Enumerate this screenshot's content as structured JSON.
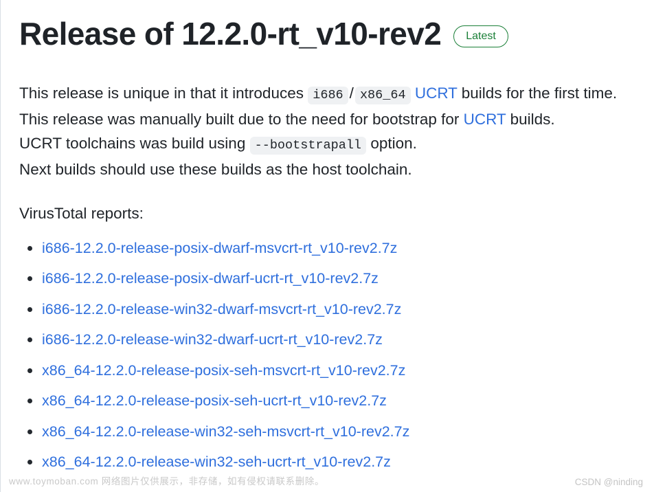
{
  "header": {
    "title": "Release of 12.2.0-rt_v10-rev2",
    "badge_label": "Latest",
    "badge_color": "#1a7f37"
  },
  "body": {
    "line1_part1": "This release is unique in that it introduces",
    "line1_code1": "i686",
    "line1_separator": "/",
    "line1_code2": "x86_64",
    "line1_link": "UCRT",
    "line1_part2": "builds for the first time.",
    "line2_part1": "This release was manually built due to the need for bootstrap for",
    "line2_link": "UCRT",
    "line2_part2": "builds.",
    "line3_part1": "UCRT toolchains was build using",
    "line3_code": "--bootstrapall",
    "line3_part2": "option.",
    "line4": "Next builds should use these builds as the host toolchain.",
    "link_color": "#2f6fdd",
    "code_bg": "#eff1f3"
  },
  "reports": {
    "heading": "VirusTotal reports:",
    "items": [
      "i686-12.2.0-release-posix-dwarf-msvcrt-rt_v10-rev2.7z",
      "i686-12.2.0-release-posix-dwarf-ucrt-rt_v10-rev2.7z",
      "i686-12.2.0-release-win32-dwarf-msvcrt-rt_v10-rev2.7z",
      "i686-12.2.0-release-win32-dwarf-ucrt-rt_v10-rev2.7z",
      "x86_64-12.2.0-release-posix-seh-msvcrt-rt_v10-rev2.7z",
      "x86_64-12.2.0-release-posix-seh-ucrt-rt_v10-rev2.7z",
      "x86_64-12.2.0-release-win32-seh-msvcrt-rt_v10-rev2.7z",
      "x86_64-12.2.0-release-win32-seh-ucrt-rt_v10-rev2.7z"
    ]
  },
  "watermarks": {
    "left": "www.toymoban.com 网络图片仅供展示，非存储，如有侵权请联系删除。",
    "right": "CSDN @ninding"
  }
}
